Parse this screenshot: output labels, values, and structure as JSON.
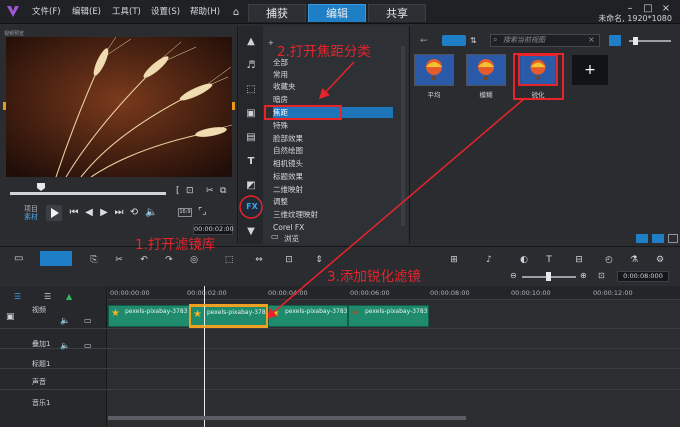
{
  "menu": [
    "文件(F)",
    "编辑(E)",
    "工具(T)",
    "设置(S)",
    "帮助(H)"
  ],
  "tabs": [
    "捕获",
    "编辑",
    "共享"
  ],
  "project_info": "未命名, 1920*1080",
  "preview": {
    "title": "视频预览",
    "mode_project": "项目",
    "mode_clip": "素材",
    "timecode": "00:00:02:00"
  },
  "library": {
    "categories": [
      "全部",
      "常用",
      "收藏夹",
      "暗房",
      "焦距",
      "特殊",
      "脸部效果",
      "自然绘图",
      "相机镜头",
      "标题效果",
      "二维映射",
      "调整",
      "三维纹理映射",
      "Corel FX"
    ],
    "selected_category": "焦距",
    "browse_label": "浏览",
    "search_placeholder": "搜索当前视图",
    "filters": [
      {
        "label": "平均"
      },
      {
        "label": "模糊"
      },
      {
        "label": "锐化"
      }
    ]
  },
  "timeline": {
    "ruler_ticks": [
      "00:00:00:00",
      "00:00:02:00",
      "00:00:04:00",
      "00:00:06:00",
      "00:00:08:00",
      "00:00:10:00",
      "00:00:12:00"
    ],
    "zoom_time": "0:00:08:000",
    "tracks": [
      {
        "name": "视频"
      },
      {
        "name": "叠加1"
      },
      {
        "name": "标题1"
      },
      {
        "name": "声音"
      },
      {
        "name": "音乐1"
      }
    ],
    "clips": [
      {
        "label": "pexels-pixabay-3783"
      },
      {
        "label": "pexels-pixabay-3783"
      },
      {
        "label": "pexels-pixabay-3783"
      },
      {
        "label": "pexels-pixabay-3783"
      }
    ]
  },
  "annotations": {
    "step1": "1.打开滤镜库",
    "step2": "2.打开焦距分类",
    "step3": "3.添加锐化滤镜"
  },
  "colors": {
    "accent": "#1f7fc6",
    "annotation": "#e8242b",
    "clip": "#1f8a6c"
  }
}
